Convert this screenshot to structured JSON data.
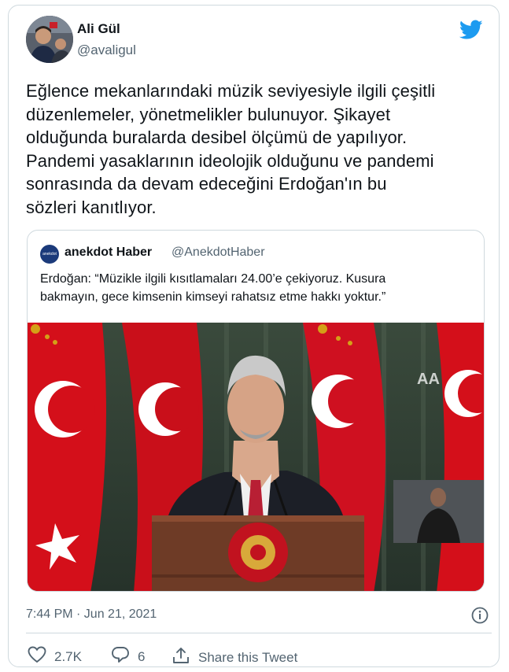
{
  "author": {
    "name": "Ali Gül",
    "handle": "@avaligul"
  },
  "tweet": {
    "text": "Eğlence mekanlarındaki müzik seviyesiyle ilgili çeşitli\ndüzenlemeler, yönetmelikler bulunuyor. Şikayet\nolduğunda buralarda desibel ölçümü de yapılıyor.\nPandemi yasaklarının ideolojik olduğunu ve pandemi\nsonrasında da devam edeceğini Erdoğan'ın bu\nsözleri kanıtlıyor.",
    "timestamp": "7:44 PM · Jun 21, 2021"
  },
  "quoted": {
    "avatar_text": "anekdot",
    "name": "anekdot Haber",
    "handle": "@AnekdotHaber",
    "text": "Erdoğan: “Müzikle ilgili kısıtlamaları 24.00’e çekiyoruz. Kusura\nbakmayın, gece kimsenin kimseyi rahatsız etme hakkı yoktur.”",
    "media_watermark": "AA"
  },
  "actions": {
    "likes": "2.7K",
    "replies": "6",
    "share_label": "Share this Tweet"
  },
  "colors": {
    "brand": "#1d9bf0",
    "secondary_text": "#536471",
    "border": "#cfd9de",
    "flag_red": "#e30a17"
  },
  "icons": [
    "twitter-bird-icon",
    "info-icon",
    "heart-icon",
    "reply-icon",
    "share-icon"
  ]
}
